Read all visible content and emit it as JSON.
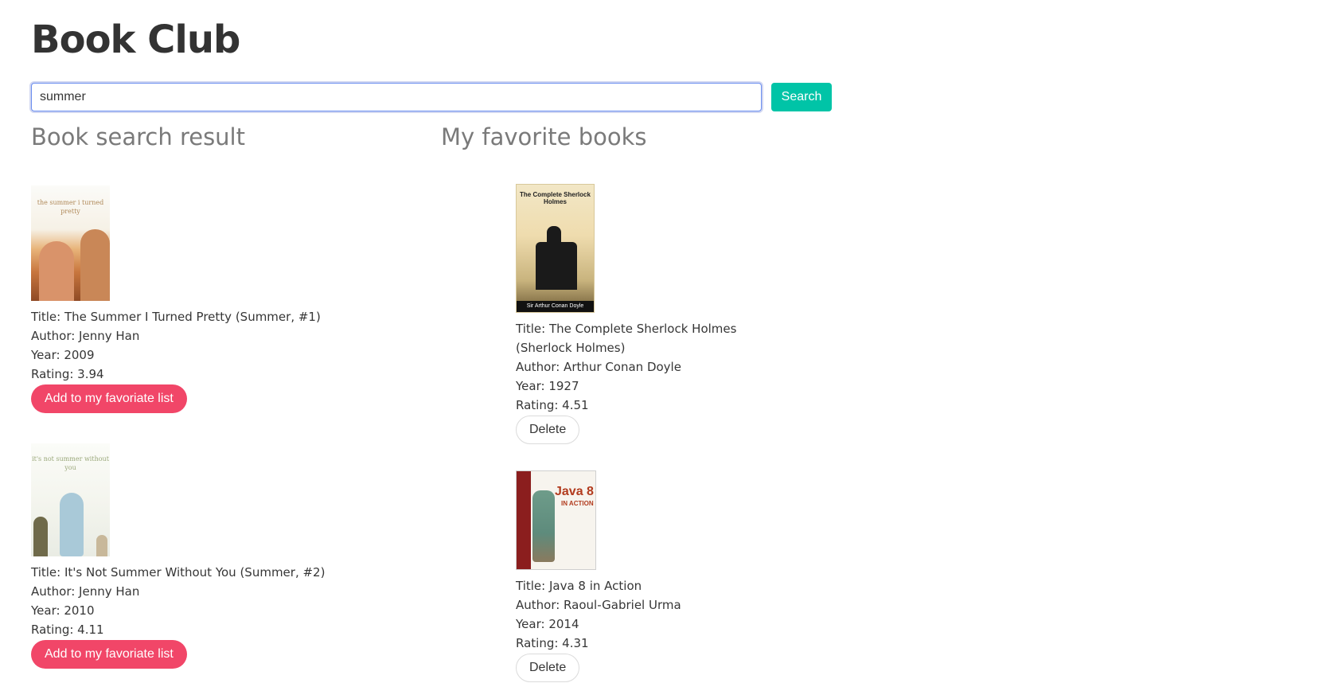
{
  "app": {
    "title": "Book Club"
  },
  "search": {
    "value": "summer",
    "button_label": "Search"
  },
  "results": {
    "heading": "Book search result",
    "action_label": "Add to my favoriate list",
    "books": [
      {
        "cover_text": "the summer i turned pretty",
        "title_line": "Title: The Summer I Turned Pretty (Summer, #1)",
        "author_line": "Author: Jenny Han",
        "year_line": "Year: 2009",
        "rating_line": "Rating: 3.94"
      },
      {
        "cover_text": "it's not summer without you",
        "title_line": "Title: It's Not Summer Without You (Summer, #2)",
        "author_line": "Author: Jenny Han",
        "year_line": "Year: 2010",
        "rating_line": "Rating: 4.11"
      }
    ]
  },
  "favorites": {
    "heading": "My favorite books",
    "action_label": "Delete",
    "books": [
      {
        "cover_text": "The Complete Sherlock Holmes",
        "cover_author": "Sir Arthur Conan Doyle",
        "title_line": "Title: The Complete Sherlock Holmes (Sherlock Holmes)",
        "author_line": "Author: Arthur Conan Doyle",
        "year_line": "Year: 1927",
        "rating_line": "Rating: 4.51"
      },
      {
        "cover_text": "Java 8",
        "cover_subtitle": "IN ACTION",
        "title_line": "Title: Java 8 in Action",
        "author_line": "Author: Raoul-Gabriel Urma",
        "year_line": "Year: 2014",
        "rating_line": "Rating: 4.31"
      }
    ]
  },
  "colors": {
    "primary": "#00c4a7",
    "danger": "#f14668",
    "heading_gray": "#7a7a7a"
  }
}
